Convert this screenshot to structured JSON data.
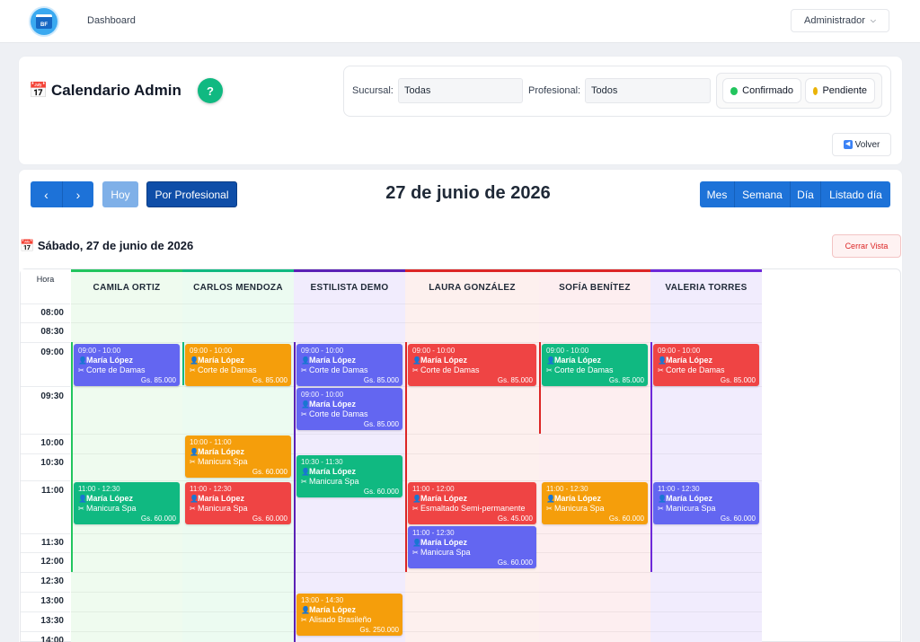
{
  "topbar": {
    "logo_text": "BF",
    "nav_dashboard": "Dashboard",
    "user_menu": "Administrador"
  },
  "header": {
    "title": "Calendario Admin",
    "help": "?",
    "sucursal_label": "Sucursal:",
    "sucursal_value": "Todas",
    "profesional_label": "Profesional:",
    "profesional_value": "Todos",
    "legend_confirmado": "Confirmado",
    "legend_pendiente": "Pendiente",
    "volver": "Volver"
  },
  "colors": {
    "confirmado": "#22c55e",
    "pendiente": "#eab308",
    "purple": "#6366f1",
    "orange": "#f59e0b",
    "red": "#ef4444",
    "green": "#10b981",
    "blue": "#1d72d8"
  },
  "toolbar": {
    "prev": "‹",
    "next": "›",
    "today": "Hoy",
    "by_professional": "Por Profesional",
    "date": "27 de junio de 2026",
    "views": [
      "Mes",
      "Semana",
      "Día",
      "Listado día"
    ]
  },
  "day": {
    "title": "Sábado, 27 de junio de 2026",
    "close": "Cerrar Vista",
    "hora": "Hora"
  },
  "times": [
    "08:00",
    "08:30",
    "09:00",
    "09:30",
    "10:00",
    "10:30",
    "11:00",
    "11:30",
    "12:00",
    "12:30",
    "13:00",
    "13:30",
    "14:00"
  ],
  "professionals": [
    {
      "name": "CAMILA ORTIZ",
      "accent": "#22c55e",
      "bg": "#effbef"
    },
    {
      "name": "CARLOS MENDOZA",
      "accent": "#10b981",
      "bg": "#ecfbf1"
    },
    {
      "name": "ESTILISTA DEMO",
      "accent": "#5b21b6",
      "bg": "#f1ecfd"
    },
    {
      "name": "LAURA GONZÁLEZ",
      "accent": "#dc2626",
      "bg": "#fdf0ee"
    },
    {
      "name": "SOFÍA BENÍTEZ",
      "accent": "#dc2626",
      "bg": "#fdeef0"
    },
    {
      "name": "VALERIA TORRES",
      "accent": "#6d28d9",
      "bg": "#f1ecfd"
    }
  ],
  "events": [
    {
      "col": 0,
      "start": "09:00",
      "time": "09:00 - 10:00",
      "client": "María López",
      "service": "Corte de Damas",
      "price": "Gs. 85.000",
      "color": "#6366f1"
    },
    {
      "col": 0,
      "start": "11:00",
      "time": "11:00 - 12:30",
      "client": "María López",
      "service": "Manicura Spa",
      "price": "Gs. 60.000",
      "color": "#10b981"
    },
    {
      "col": 1,
      "start": "09:00",
      "time": "09:00 - 10:00",
      "client": "María López",
      "service": "Corte de Damas",
      "price": "Gs. 85.000",
      "color": "#f59e0b"
    },
    {
      "col": 1,
      "start": "10:00",
      "time": "10:00 - 11:00",
      "client": "María López",
      "service": "Manicura Spa",
      "price": "Gs. 60.000",
      "color": "#f59e0b"
    },
    {
      "col": 1,
      "start": "11:00",
      "time": "11:00 - 12:30",
      "client": "María López",
      "service": "Manicura Spa",
      "price": "Gs. 60.000",
      "color": "#ef4444"
    },
    {
      "col": 2,
      "start": "09:00",
      "time": "09:00 - 10:00",
      "client": "María López",
      "service": "Corte de Damas",
      "price": "Gs. 85.000",
      "color": "#6366f1"
    },
    {
      "col": 2,
      "start": "09:30",
      "time": "09:00 - 10:00",
      "client": "María López",
      "service": "Corte de Damas",
      "price": "Gs. 85.000",
      "color": "#6366f1"
    },
    {
      "col": 2,
      "start": "10:30",
      "time": "10:30 - 11:30",
      "client": "María López",
      "service": "Manicura Spa",
      "price": "Gs. 60.000",
      "color": "#10b981"
    },
    {
      "col": 2,
      "start": "13:00",
      "time": "13:00 - 14:30",
      "client": "María López",
      "service": "Alisado Brasileño",
      "price": "Gs. 250.000",
      "color": "#f59e0b"
    },
    {
      "col": 3,
      "start": "09:00",
      "time": "09:00 - 10:00",
      "client": "María López",
      "service": "Corte de Damas",
      "price": "Gs. 85.000",
      "color": "#ef4444"
    },
    {
      "col": 3,
      "start": "11:00",
      "time": "11:00 - 12:00",
      "client": "María López",
      "service": "Esmaltado Semi-permanente",
      "price": "Gs. 45.000",
      "color": "#ef4444"
    },
    {
      "col": 3,
      "start": "11:30",
      "time": "11:00 - 12:30",
      "client": "María López",
      "service": "Manicura Spa",
      "price": "Gs. 60.000",
      "color": "#6366f1"
    },
    {
      "col": 4,
      "start": "09:00",
      "time": "09:00 - 10:00",
      "client": "María López",
      "service": "Corte de Damas",
      "price": "Gs. 85.000",
      "color": "#10b981"
    },
    {
      "col": 4,
      "start": "11:00",
      "time": "11:00 - 12:30",
      "client": "María López",
      "service": "Manicura Spa",
      "price": "Gs. 60.000",
      "color": "#f59e0b"
    },
    {
      "col": 5,
      "start": "09:00",
      "time": "09:00 - 10:00",
      "client": "María López",
      "service": "Corte de Damas",
      "price": "Gs. 85.000",
      "color": "#ef4444"
    },
    {
      "col": 5,
      "start": "11:00",
      "time": "11:00 - 12:30",
      "client": "María López",
      "service": "Manicura Spa",
      "price": "Gs. 60.000",
      "color": "#6366f1"
    }
  ]
}
